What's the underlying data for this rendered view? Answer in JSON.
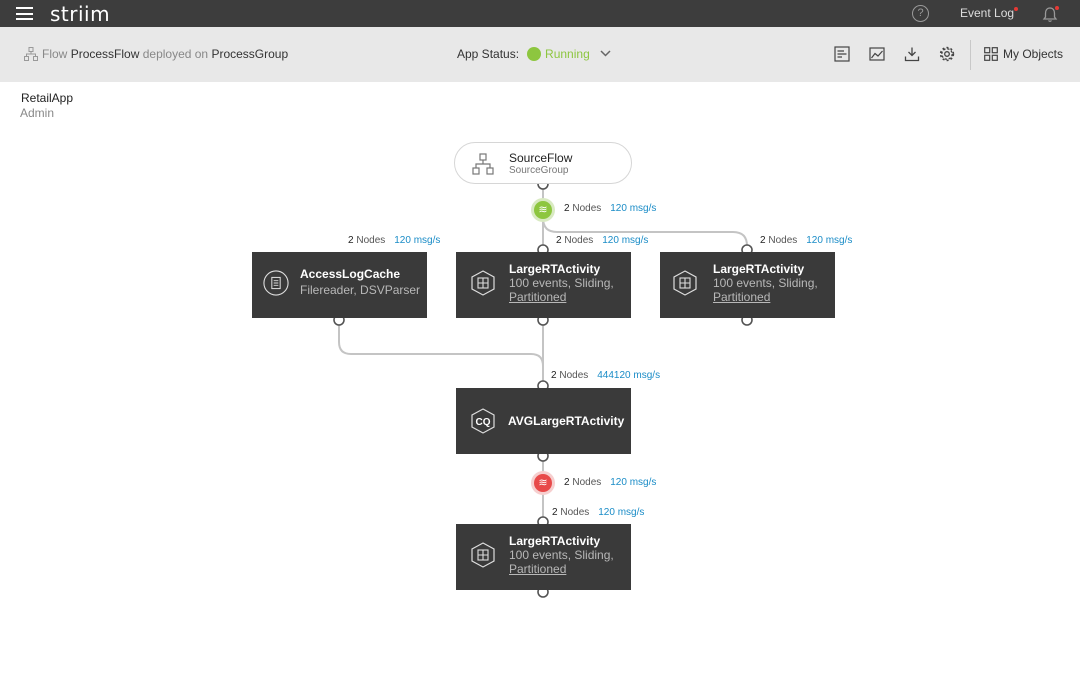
{
  "topbar": {
    "logo": "striim",
    "help": "?",
    "event_log": "Event Log"
  },
  "subheader": {
    "flow_label": "Flow",
    "flow_name": "ProcessFlow",
    "deployed_text": "deployed on",
    "group_name": "ProcessGroup",
    "app_status_label": "App Status:",
    "app_status_value": "Running",
    "my_objects": "My Objects"
  },
  "app": {
    "name": "RetailApp",
    "owner": "Admin"
  },
  "source": {
    "title": "SourceFlow",
    "subtitle": "SourceGroup"
  },
  "stats": {
    "nodes_label": "Nodes",
    "stream1": {
      "count": "2",
      "rate": "120 msg/s"
    },
    "cache": {
      "count": "2",
      "rate": "120 msg/s"
    },
    "window1": {
      "count": "2",
      "rate": "120 msg/s"
    },
    "window2": {
      "count": "2",
      "rate": "120 msg/s"
    },
    "cq": {
      "count": "2",
      "rate": "444120 msg/s"
    },
    "stream2": {
      "count": "2",
      "rate": "120 msg/s"
    },
    "window3": {
      "count": "2",
      "rate": "120 msg/s"
    }
  },
  "nodes": {
    "cache": {
      "title": "AccessLogCache",
      "sub": "Filereader, DSVParser"
    },
    "window1": {
      "title": "LargeRTActivity",
      "sub": "100 events, Sliding,",
      "link": "Partitioned"
    },
    "window2": {
      "title": "LargeRTActivity",
      "sub": "100 events, Sliding,",
      "link": "Partitioned"
    },
    "cq": {
      "title": "AVGLargeRTActivity",
      "icon": "CQ"
    },
    "window3": {
      "title": "LargeRTActivity",
      "sub": "100 events, Sliding,",
      "link": "Partitioned"
    }
  },
  "colors": {
    "running": "#8dc63f",
    "stream_ok": "#8dc63f",
    "stream_error": "#e84a4a",
    "rate": "#1a8cc7",
    "node_bg": "#3a3a3a"
  },
  "icons": {
    "menu": "hamburger-icon",
    "help": "help-icon",
    "bell": "bell-icon",
    "flow": "flow-icon",
    "dashboard": "dashboard-icon",
    "monitor": "monitor-icon",
    "export": "export-icon",
    "settings": "gear-icon",
    "my_objects": "grid-icon",
    "stream": "stream-icon",
    "cache": "cache-icon",
    "window": "window-icon",
    "cq": "cq-icon"
  }
}
